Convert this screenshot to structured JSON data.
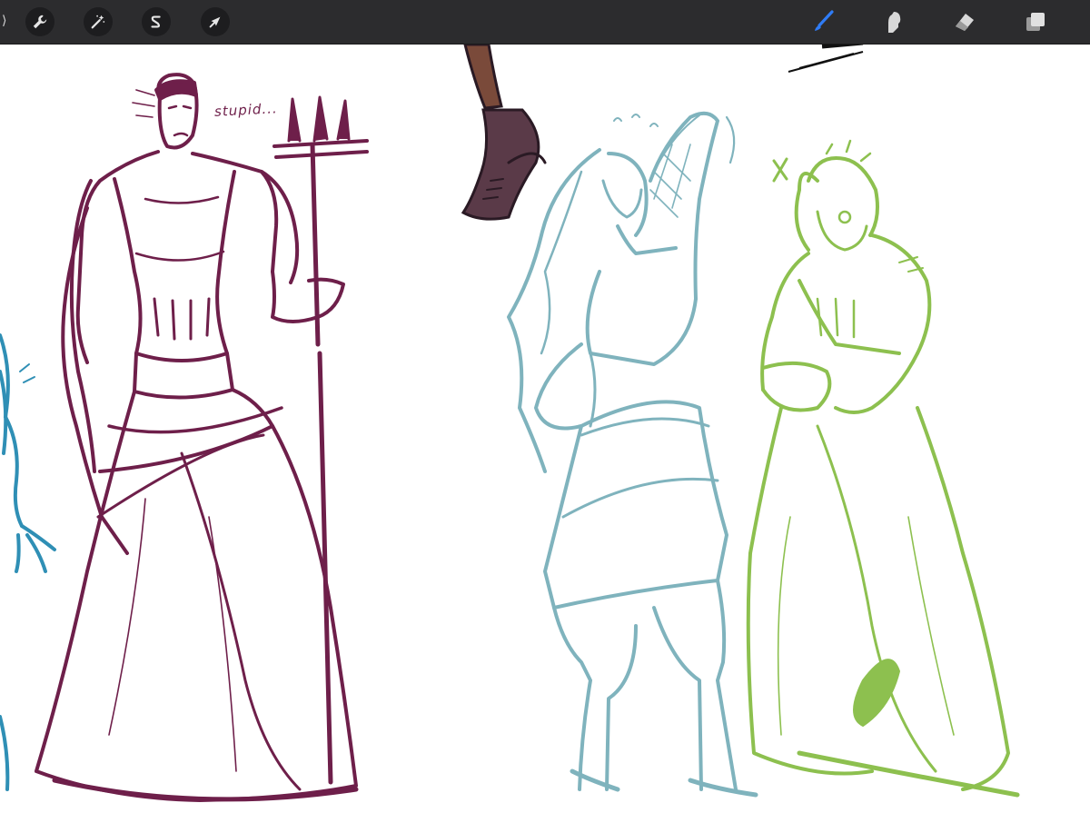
{
  "toolbar": {
    "left_tools": [
      {
        "name": "actions",
        "icon": "wrench-icon"
      },
      {
        "name": "adjustments",
        "icon": "magic-wand-icon"
      },
      {
        "name": "selection",
        "icon": "selection-s-icon"
      },
      {
        "name": "transform",
        "icon": "arrow-cursor-icon"
      }
    ],
    "right_tools": [
      {
        "name": "brush",
        "icon": "brush-icon",
        "active": true
      },
      {
        "name": "smudge",
        "icon": "smudge-icon"
      },
      {
        "name": "eraser",
        "icon": "eraser-icon"
      },
      {
        "name": "layers",
        "icon": "layers-icon"
      }
    ],
    "active_color": "#2f7cf6"
  },
  "canvas": {
    "annotation_text": "stupid...",
    "figures": [
      {
        "name": "maroon-figure-with-trident",
        "color": "#6e1f4a"
      },
      {
        "name": "teal-figure",
        "color": "#7fb3bd"
      },
      {
        "name": "green-figure",
        "color": "#8dc04f"
      },
      {
        "name": "blue-partial-figure",
        "color": "#2f8fb5"
      },
      {
        "name": "boot-leg-sketch",
        "color": "#4a2a38"
      }
    ]
  }
}
